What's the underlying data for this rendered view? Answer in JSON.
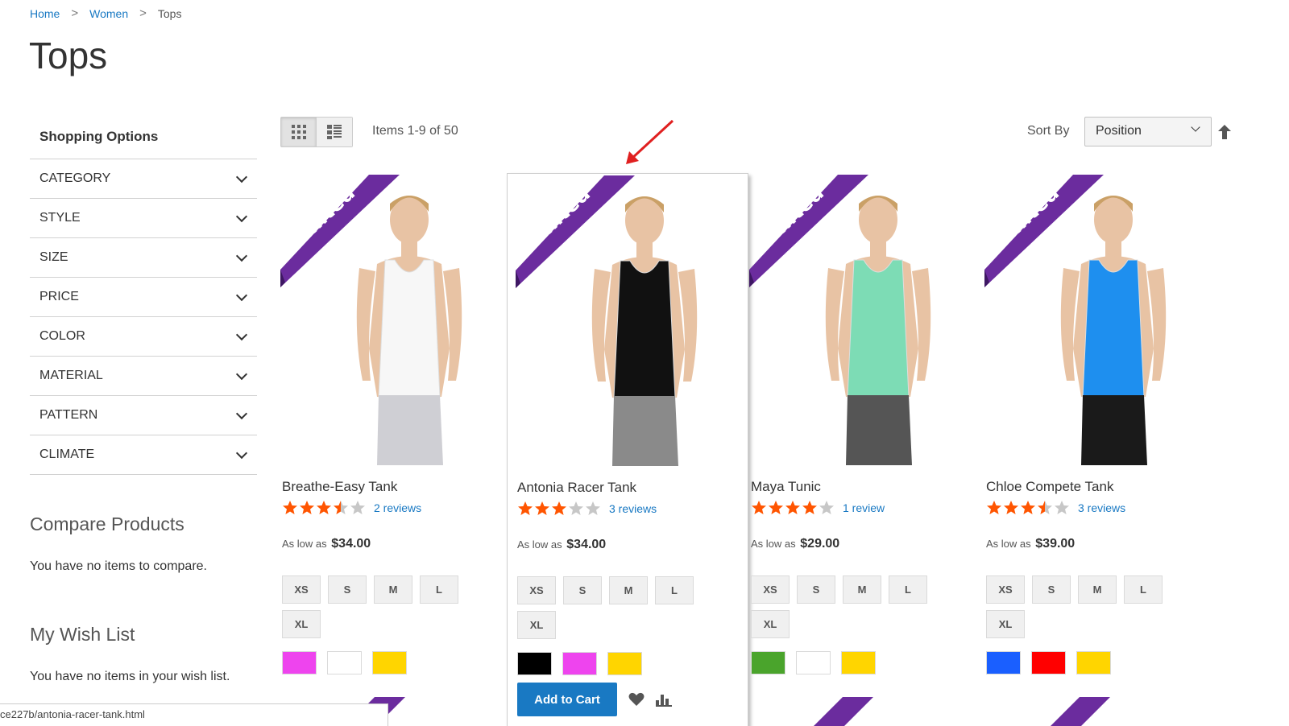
{
  "breadcrumb": {
    "items": [
      "Home",
      "Women"
    ],
    "current": "Tops",
    "separator": ">"
  },
  "page": {
    "title": "Tops"
  },
  "sidebar": {
    "title": "Shopping Options",
    "filters": [
      "CATEGORY",
      "STYLE",
      "SIZE",
      "PRICE",
      "COLOR",
      "MATERIAL",
      "PATTERN",
      "CLIMATE"
    ],
    "compare": {
      "title": "Compare Products",
      "text": "You have no items to compare."
    },
    "wishlist": {
      "title": "My Wish List",
      "text": "You have no items in your wish list."
    }
  },
  "toolbar": {
    "view_modes": [
      "grid-icon",
      "list-icon"
    ],
    "active_mode": "grid",
    "amount": "Items 1-9 of 50",
    "sort_label": "Sort By",
    "sort_value": "Position",
    "sort_direction_icon": "arrow-up-icon"
  },
  "products": [
    {
      "name": "Breathe-Easy Tank",
      "ribbon": "limited",
      "rating": 3.5,
      "reviews": "2 reviews",
      "price_prefix": "As low as",
      "price": "$34.00",
      "sizes": [
        "XS",
        "S",
        "M",
        "L",
        "XL"
      ],
      "swatches": [
        "#ee44ee",
        "#ffffff",
        "#ffd500"
      ],
      "shirt_color": "#f7f7f7",
      "bottom_color": "#cfcfd4"
    },
    {
      "name": "Antonia Racer Tank",
      "ribbon": "limited",
      "rating": 3,
      "reviews": "3 reviews",
      "price_prefix": "As low as",
      "price": "$34.00",
      "sizes": [
        "XS",
        "S",
        "M",
        "L",
        "XL"
      ],
      "swatches": [
        "#000000",
        "#ee44ee",
        "#ffd500"
      ],
      "shirt_color": "#111111",
      "bottom_color": "#8a8a8a",
      "add_to_cart": "Add to Cart"
    },
    {
      "name": "Maya Tunic",
      "ribbon": "limited",
      "rating": 4,
      "reviews": "1 review",
      "price_prefix": "As low as",
      "price": "$29.00",
      "sizes": [
        "XS",
        "S",
        "M",
        "L",
        "XL"
      ],
      "swatches": [
        "#4aa42c",
        "#ffffff",
        "#ffd500"
      ],
      "shirt_color": "#7ddcb5",
      "bottom_color": "#555555"
    },
    {
      "name": "Chloe Compete Tank",
      "ribbon": "limited",
      "rating": 3.5,
      "reviews": "3 reviews",
      "price_prefix": "As low as",
      "price": "$39.00",
      "sizes": [
        "XS",
        "S",
        "M",
        "L",
        "XL"
      ],
      "swatches": [
        "#1a5fff",
        "#ff0000",
        "#ffd500"
      ],
      "shirt_color": "#1e8fef",
      "bottom_color": "#1a1a1a"
    }
  ],
  "status_bar": {
    "url": "ce227b/antonia-racer-tank.html"
  },
  "colors": {
    "link": "#1979c3",
    "ribbon": "#6b2c9e",
    "star": "#ff5501",
    "star_empty": "#c7c7c7"
  }
}
